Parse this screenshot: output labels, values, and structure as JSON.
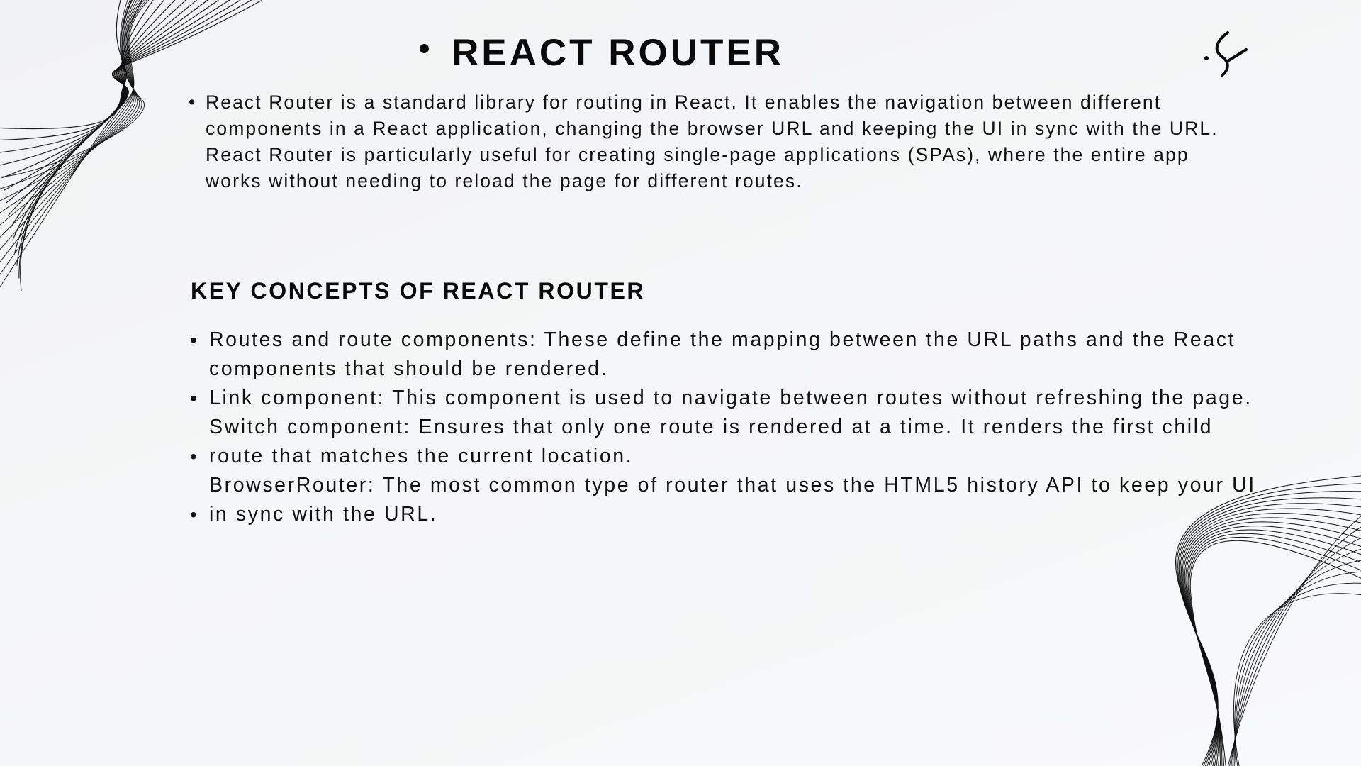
{
  "slide": {
    "title": "REACT ROUTER",
    "intro": "React Router is a standard library for routing in React. It enables the navigation between different\ncomponents in a React application, changing the browser URL and keeping the UI in sync with the URL.\nReact Router is particularly useful for creating single-page applications (SPAs), where the entire app\nworks without needing to reload the page for different routes.",
    "section_heading": "KEY CONCEPTS OF REACT ROUTER",
    "concepts_text": "Routes and route components: These define the mapping between the URL paths and the React\ncomponents that should be rendered.\nLink component: This component is used to navigate between routes without refreshing the page.\nSwitch component: Ensures that only one route is rendered at a time. It renders the first child\nroute that matches the current location.\nBrowserRouter: The most common type of router that uses the HTML5 history API to keep your UI\nin sync with the URL.",
    "bullet_glyph": "•"
  },
  "icons": {
    "logo": "brand-logo-icon",
    "wave_top_left": "wave-lines-decoration",
    "wave_bottom_right": "wave-lines-decoration"
  },
  "colors": {
    "text": "#111111",
    "background": "#f4f5f6",
    "line_art": "#111111"
  }
}
